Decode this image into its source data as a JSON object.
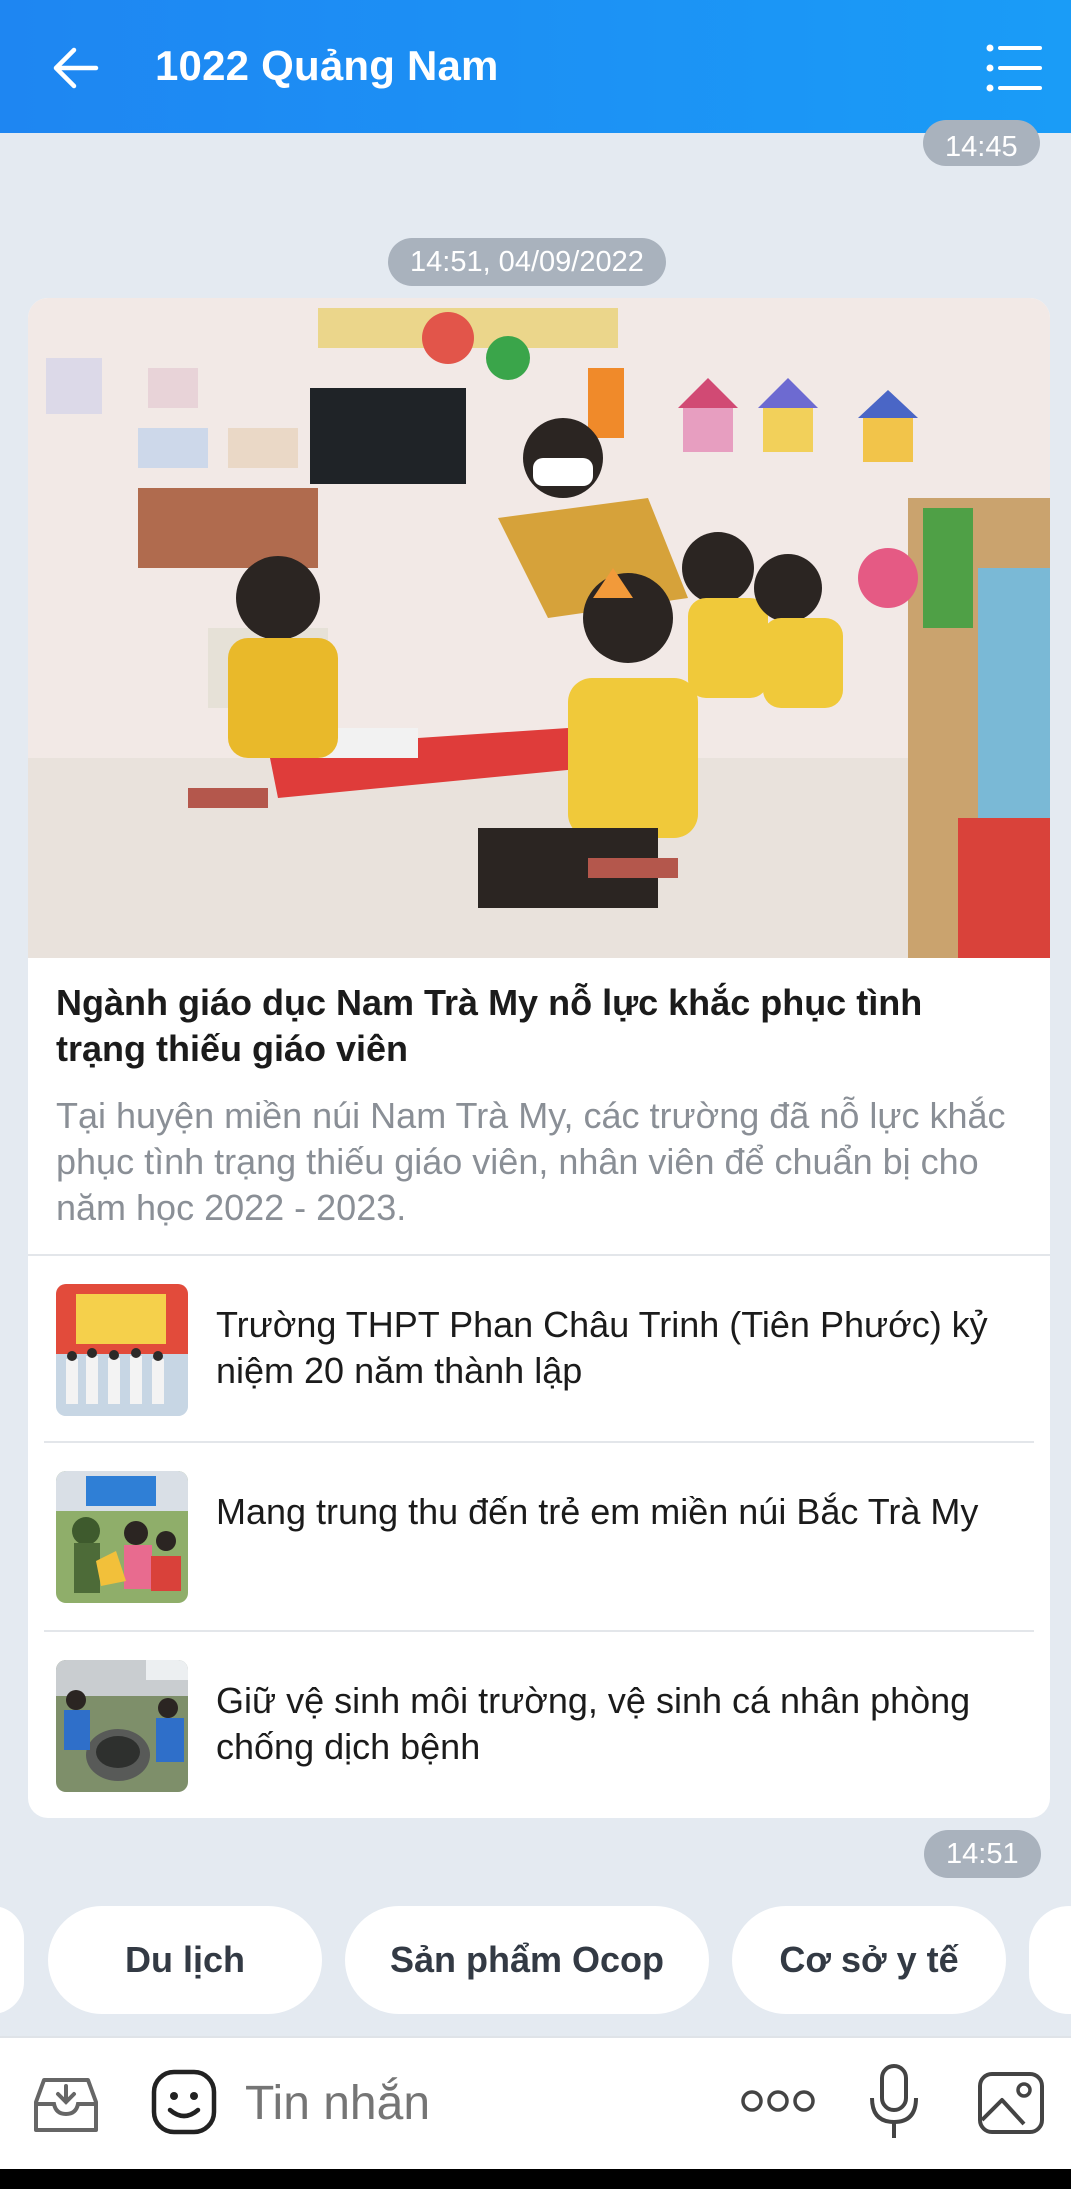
{
  "header": {
    "title": "1022 Quảng Nam",
    "back_icon": "arrow-left-icon",
    "menu_icon": "list-icon"
  },
  "messages": {
    "prev_time": "14:45",
    "date_separator": "14:51, 04/09/2022",
    "card_time": "14:51"
  },
  "card": {
    "main": {
      "title": "Ngành giáo dục Nam Trà My nỗ lực khắc phục tình trạng thiếu giáo viên",
      "description": "Tại huyện miền núi Nam Trà My, các trường đã nỗ lực khắc phục tình trạng thiếu giáo viên, nhân viên để chuẩn bị cho năm học 2022 - 2023."
    },
    "items": [
      {
        "title": "Trường THPT Phan Châu Trinh (Tiên Phước) kỷ niệm 20 năm thành lập"
      },
      {
        "title": "Mang trung thu đến trẻ em miền núi Bắc Trà My"
      },
      {
        "title": "Giữ vệ sinh môi trường, vệ sinh cá nhân phòng chống dịch bệnh"
      }
    ]
  },
  "quick_replies": [
    "Du lịch",
    "Sản phẩm Ocop",
    "Cơ sở y tế"
  ],
  "input": {
    "placeholder": "Tin nhắn",
    "icons": [
      "inbox-icon",
      "emoji-icon",
      "more-icon",
      "microphone-icon",
      "image-icon"
    ]
  },
  "colors": {
    "header": "#1e86f2",
    "background": "#e4eaf1",
    "badge": "#a9b2bd"
  }
}
